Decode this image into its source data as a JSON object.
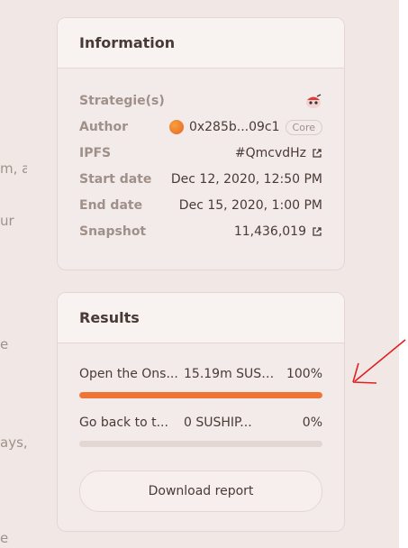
{
  "background_fragments": [
    "m, a",
    "ur",
    "e",
    "ays,",
    "e"
  ],
  "information": {
    "title": "Information",
    "rows": [
      {
        "label": "Strategie(s)",
        "value": ""
      },
      {
        "label": "Author",
        "value": "0x285b...09c1",
        "badge": "Core"
      },
      {
        "label": "IPFS",
        "value": "#QmcvdHz"
      },
      {
        "label": "Start date",
        "value": "Dec 12, 2020, 12:50 PM"
      },
      {
        "label": "End date",
        "value": "Dec 15, 2020, 1:00 PM"
      },
      {
        "label": "Snapshot",
        "value": "11,436,019"
      }
    ]
  },
  "results": {
    "title": "Results",
    "choices": [
      {
        "choice": "Open the Ons...",
        "amount": "15.19m SUSHIP...",
        "percent_text": "100%",
        "percent": 100
      },
      {
        "choice": "Go back to t...",
        "amount": "0 SUSHIP...",
        "percent_text": "0%",
        "percent": 0
      }
    ],
    "download_label": "Download report"
  },
  "colors": {
    "accent": "#f07534",
    "annotation": "#e02020"
  },
  "icons": [
    "strategy-icon",
    "author-avatar-icon",
    "external-link-icon"
  ]
}
